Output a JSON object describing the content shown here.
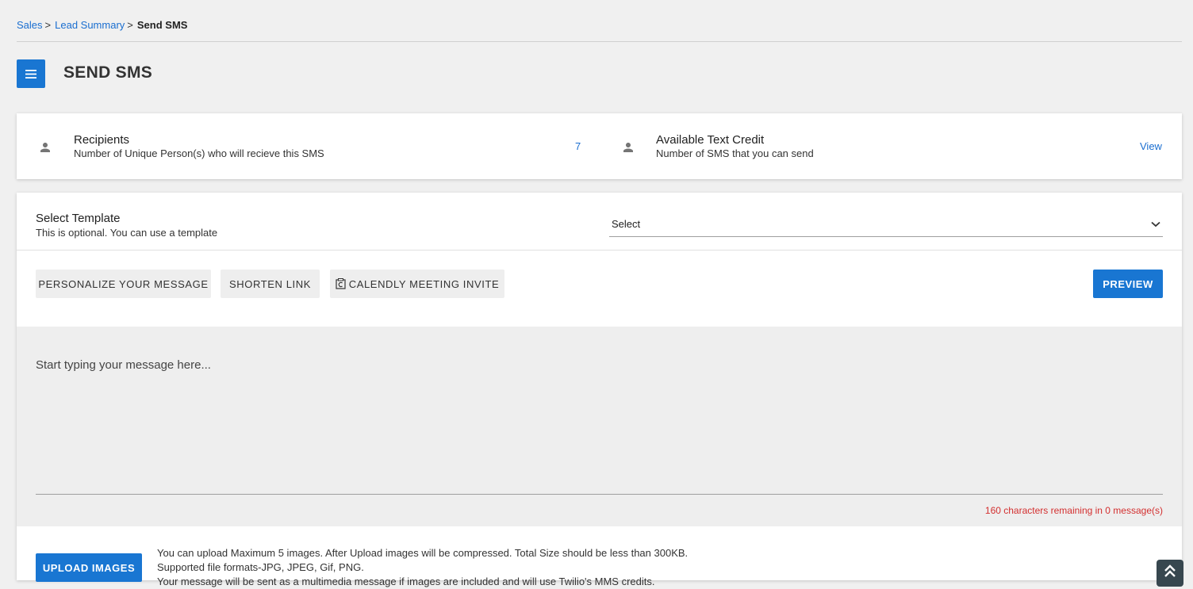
{
  "breadcrumb": {
    "items": [
      {
        "label": "Sales"
      },
      {
        "label": "Lead Summary"
      }
    ],
    "separator": ">",
    "current": "Send SMS"
  },
  "header": {
    "title": "SEND SMS",
    "menu_icon": "hamburger-menu-icon"
  },
  "recipients": {
    "title": "Recipients",
    "subtitle": "Number of Unique Person(s) who will recieve this SMS",
    "value": "7"
  },
  "credit": {
    "title": "Available Text Credit",
    "subtitle": "Number of SMS that you can send",
    "link": "View"
  },
  "template": {
    "label": "Select Template",
    "sub": "This is optional. You can use a template",
    "selected": "Select"
  },
  "toolbar": {
    "personalize": "PERSONALIZE YOUR MESSAGE",
    "shorten": "SHORTEN LINK",
    "calendly": "CALENDLY MEETING INVITE",
    "preview": "PREVIEW"
  },
  "message": {
    "placeholder": "Start typing your message here...",
    "remaining": "160 characters remaining in 0 message(s)"
  },
  "upload": {
    "button": "UPLOAD IMAGES",
    "line1": "You can upload Maximum 5 images. After Upload images will be compressed. Total Size should be less than 300KB.",
    "line2": "Supported file formats-JPG, JPEG, Gif, PNG.",
    "line3": "Your message will be sent as a multimedia message if images are included and will use Twilio's MMS credits."
  },
  "colors": {
    "primary": "#1976d2",
    "link": "#1a6ed0",
    "warning": "#d32f2f"
  }
}
